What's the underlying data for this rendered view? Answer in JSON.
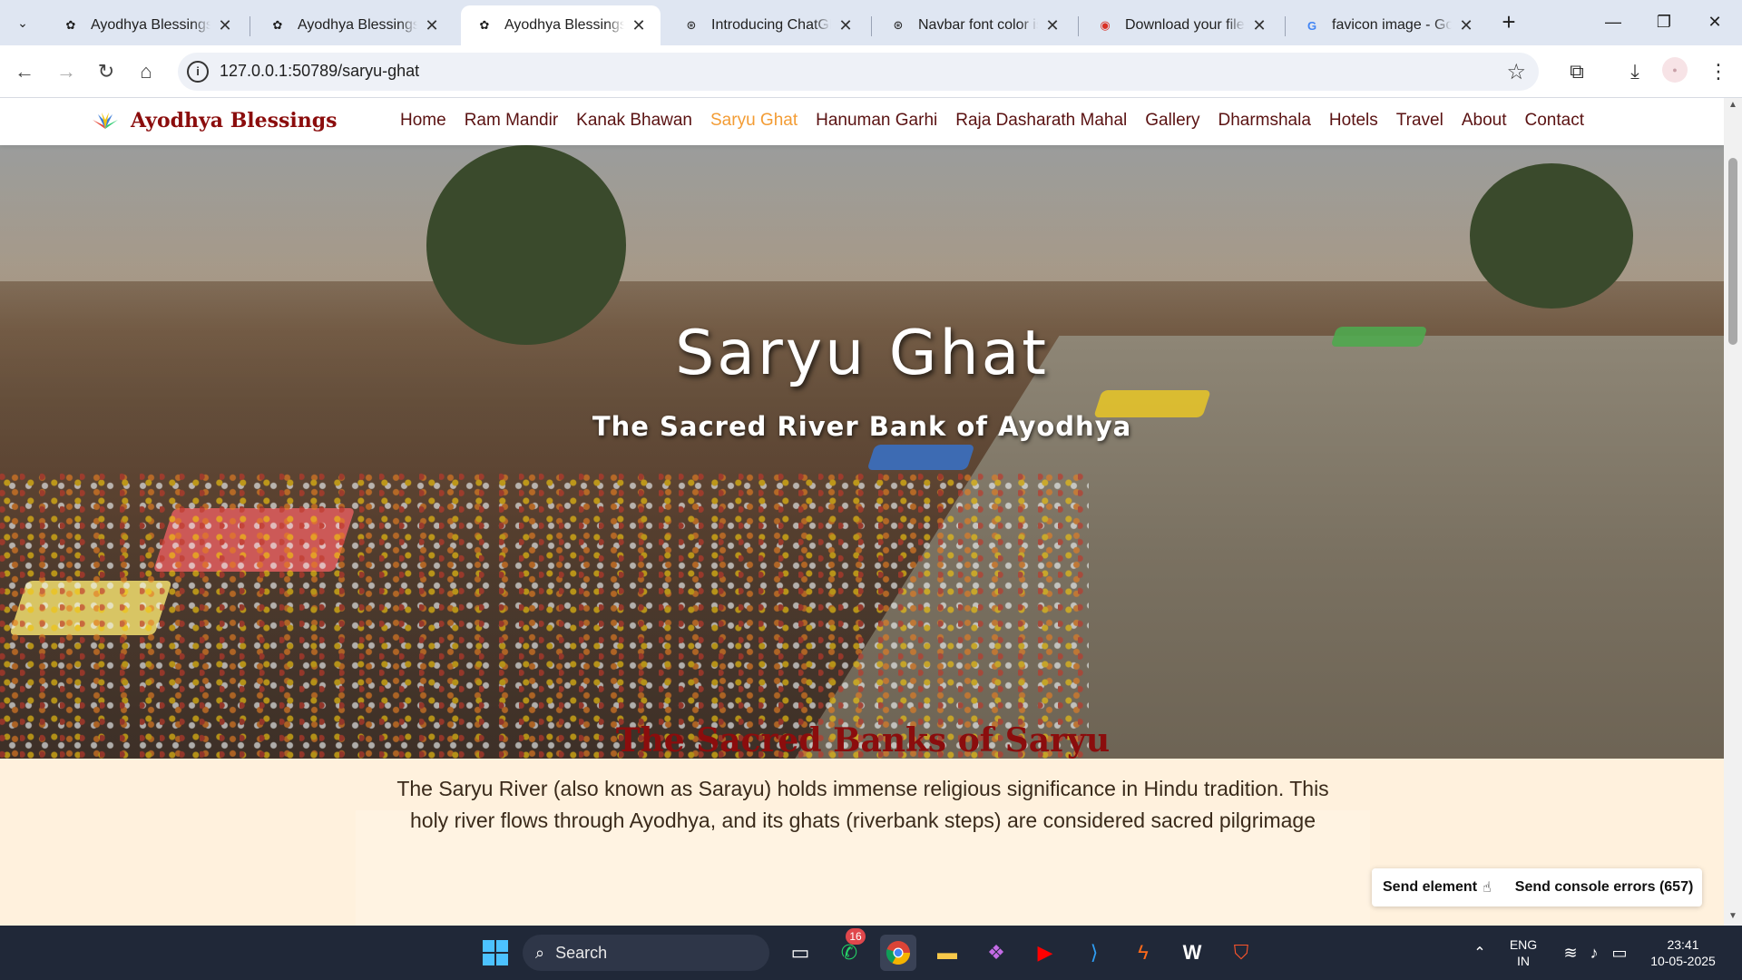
{
  "browser": {
    "tabs": [
      {
        "title": "Ayodhya Blessings - ",
        "active": false,
        "favicon": "flower-icon"
      },
      {
        "title": "Ayodhya Blessings - ",
        "active": false,
        "favicon": "flower-icon"
      },
      {
        "title": "Ayodhya Blessings - ",
        "active": true,
        "favicon": "flower-icon"
      },
      {
        "title": "Introducing ChatGPT",
        "active": false,
        "favicon": "openai-icon"
      },
      {
        "title": "Navbar font color iss",
        "active": false,
        "favicon": "openai-icon"
      },
      {
        "title": "Download your file –",
        "active": false,
        "favicon": "pdf-icon"
      },
      {
        "title": "favicon image - Goo",
        "active": false,
        "favicon": "google-icon"
      }
    ],
    "url": "127.0.0.1:50789/saryu-ghat"
  },
  "site": {
    "brand": "Ayodhya Blessings",
    "nav": [
      {
        "label": "Home"
      },
      {
        "label": "Ram Mandir"
      },
      {
        "label": "Kanak Bhawan"
      },
      {
        "label": "Saryu Ghat",
        "active": true
      },
      {
        "label": "Hanuman Garhi"
      },
      {
        "label": "Raja Dasharath Mahal"
      },
      {
        "label": "Gallery"
      },
      {
        "label": "Dharmshala"
      },
      {
        "label": "Hotels"
      },
      {
        "label": "Travel"
      },
      {
        "label": "About"
      },
      {
        "label": "Contact"
      }
    ],
    "hero": {
      "title": "Saryu Ghat",
      "subtitle": "The Sacred River Bank of Ayodhya"
    },
    "section": {
      "title": "The Sacred Banks of Saryu",
      "text_line1": "The Saryu River (also known as Sarayu) holds immense religious significance in Hindu tradition. This",
      "text_line2": "holy river flows through Ayodhya, and its ghats (riverbank steps) are considered sacred pilgrimage"
    },
    "colors": {
      "accent": "#f39c34",
      "brand": "#8b0d0d",
      "page_bg": "#fff1dd"
    }
  },
  "devbar": {
    "send_element": "Send element",
    "send_console": "Send console errors (657)"
  },
  "taskbar": {
    "search_label": "Search",
    "whatsapp_badge": "16",
    "lang_line1": "ENG",
    "lang_line2": "IN",
    "time": "23:41",
    "date": "10-05-2025"
  }
}
